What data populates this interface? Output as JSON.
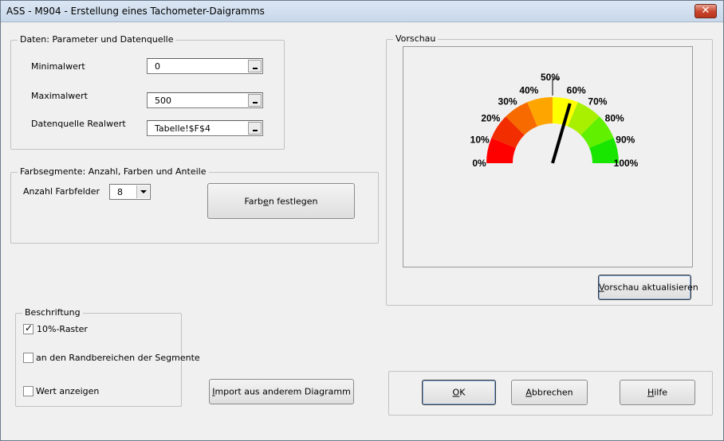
{
  "window": {
    "title": "ASS - M904 - Erstellung eines Tachometer-Daigramms",
    "close_glyph": "✕"
  },
  "params_group": {
    "label": "Daten: Parameter und Datenquelle",
    "min_label": "Minimalwert",
    "min_value": "0",
    "max_label": "Maximalwert",
    "max_value": "500",
    "source_label": "Datenquelle Realwert",
    "source_value": "Tabelle!$F$4"
  },
  "segments_group": {
    "label": "Farbsegmente: Anzahl, Farben und Anteile",
    "count_label": "Anzahl Farbfelder",
    "count_value": "8",
    "colors_button": {
      "pre": "Farb",
      "accel": "e",
      "post": "n festlegen"
    }
  },
  "label_group": {
    "label": "Beschriftung",
    "options": [
      {
        "label": "10%-Raster",
        "checked": true
      },
      {
        "label": "an den Randbereichen der Segmente",
        "checked": false
      },
      {
        "label": "Wert anzeigen",
        "checked": false
      }
    ]
  },
  "import_button": {
    "accel": "I",
    "post": "mport aus anderem Diagramm"
  },
  "preview_group": {
    "label": "Vorschau",
    "refresh_button": {
      "accel": "V",
      "post": "orschau aktualisieren"
    }
  },
  "dialog_buttons": {
    "ok": {
      "accel": "O",
      "post": "K"
    },
    "cancel": {
      "accel": "A",
      "post": "bbrechen"
    },
    "help": {
      "accel": "H",
      "post": "ilfe"
    }
  },
  "gauge": {
    "ticks": [
      "0%",
      "10%",
      "20%",
      "30%",
      "40%",
      "50%",
      "60%",
      "70%",
      "80%",
      "90%",
      "100%"
    ],
    "segments": [
      "#ff0000",
      "#f22d00",
      "#f76a00",
      "#ffa500",
      "#ffff00",
      "#a8f000",
      "#60f000",
      "#19e600"
    ],
    "needle_fraction": 0.59,
    "highlight_tick": "50%"
  }
}
